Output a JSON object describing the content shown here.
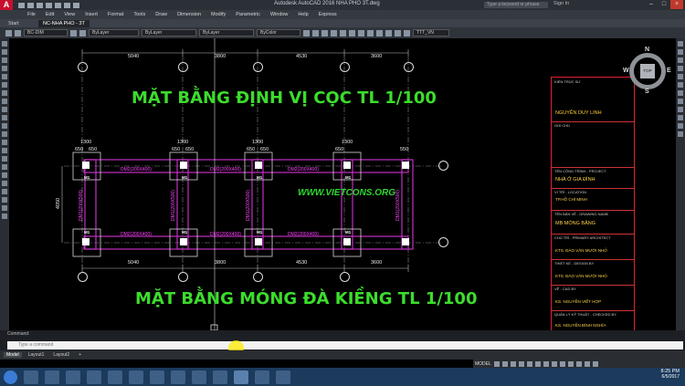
{
  "app": {
    "window_title": "Autodesk AutoCAD 2016   NHA PHO 3T.dwg",
    "search_placeholder": "Type a keyword or phrase",
    "user": "Sign In"
  },
  "menu": [
    "File",
    "Edit",
    "View",
    "Insert",
    "Format",
    "Tools",
    "Draw",
    "Dimension",
    "Modify",
    "Parametric",
    "Window",
    "Help",
    "Express"
  ],
  "ribbon": {
    "tabs": [
      "Start",
      "NC-NHA PHO - 3T"
    ],
    "active_tab": 1
  },
  "properties": {
    "layer": "BC-DIM",
    "color": "ByLayer",
    "linetype": "ByLayer",
    "lineweight": "ByLayer",
    "plotstyle": "ByColor",
    "textstyle": "TTT_VN"
  },
  "drawing": {
    "title_plan": "MẶT BẰNG ĐỊNH VỊ CỌC TL 1/100",
    "title_foundation": "MẶT BẰNG MÓNG ĐÀ KIỀNG TL 1/100",
    "watermark": "WWW.VIETCONS.ORG",
    "top_dims": [
      "5040",
      "3800",
      "4530",
      "3600"
    ],
    "bottom_dims": [
      "5040",
      "3800",
      "4530",
      "3600"
    ],
    "foot_dims_top": [
      "1300",
      "1300",
      "1300",
      "1300"
    ],
    "foot_dims_sub": [
      "650",
      "650",
      "650",
      "650",
      "650",
      "650",
      "650",
      "550"
    ],
    "side_dim": "4050",
    "beams_top": [
      "DM2(200X400)",
      "DM2(200X400)",
      "DM2(200X400)"
    ],
    "beams_bottom": [
      "DM2(200X400)",
      "DM2(200X400)",
      "DM2(200X400)"
    ],
    "beams_vertical": [
      "DM1(200X500)",
      "DM1(200X500)",
      "DM1(200X500)",
      "DM1(200X500)"
    ],
    "col_labels": [
      "M1",
      "M1",
      "M1",
      "M1",
      "M1",
      "M1",
      "M1",
      "M1"
    ]
  },
  "titleblock": {
    "architect_label": "KIẾN TRÚC SƯ",
    "architect": "NGUYỄN DUY LINH",
    "notes_label": "GHI CHÚ",
    "project_label": "TÊN CÔNG TRÌNH - PROJECT",
    "project": "NHÀ Ở GIA ĐÌNH",
    "location_label": "VỊ TRÍ - LOCATION",
    "location": "TP.HỒ CHÍ MINH",
    "drawing_label": "TÊN BẢN VẼ - DRAWING NAME",
    "drawing": "MB MÓNG BĂNG",
    "chief_label": "CHỦ TRÌ - PRIMARY ARCHITECT",
    "chief": "KTS. ĐÀO VĂN MƯỜI NHỎ",
    "design_label": "THIẾT KẾ - DESIGN BY",
    "design": "KTS. ĐÀO VĂN MƯỜI NHỎ",
    "check_label": "VẼ - CAD BY",
    "check": "KS. NGUYỄN VIẾT HỢP",
    "manager_label": "QUẢN LÝ KỸ THUẬT - CHECKED BY",
    "manager": "KS. NGUYỄN ĐÌNH NGHĨA"
  },
  "viewcube": {
    "top": "TOP",
    "n": "N",
    "s": "S",
    "e": "E",
    "w": "W"
  },
  "command": {
    "history": "Command:",
    "placeholder": "Type a command"
  },
  "layout_tabs": [
    "Model",
    "Layout1",
    "Layout2"
  ],
  "status": {
    "mode": "MODEL"
  },
  "clock": {
    "time": "8:25 PM",
    "date": "6/5/2017"
  }
}
